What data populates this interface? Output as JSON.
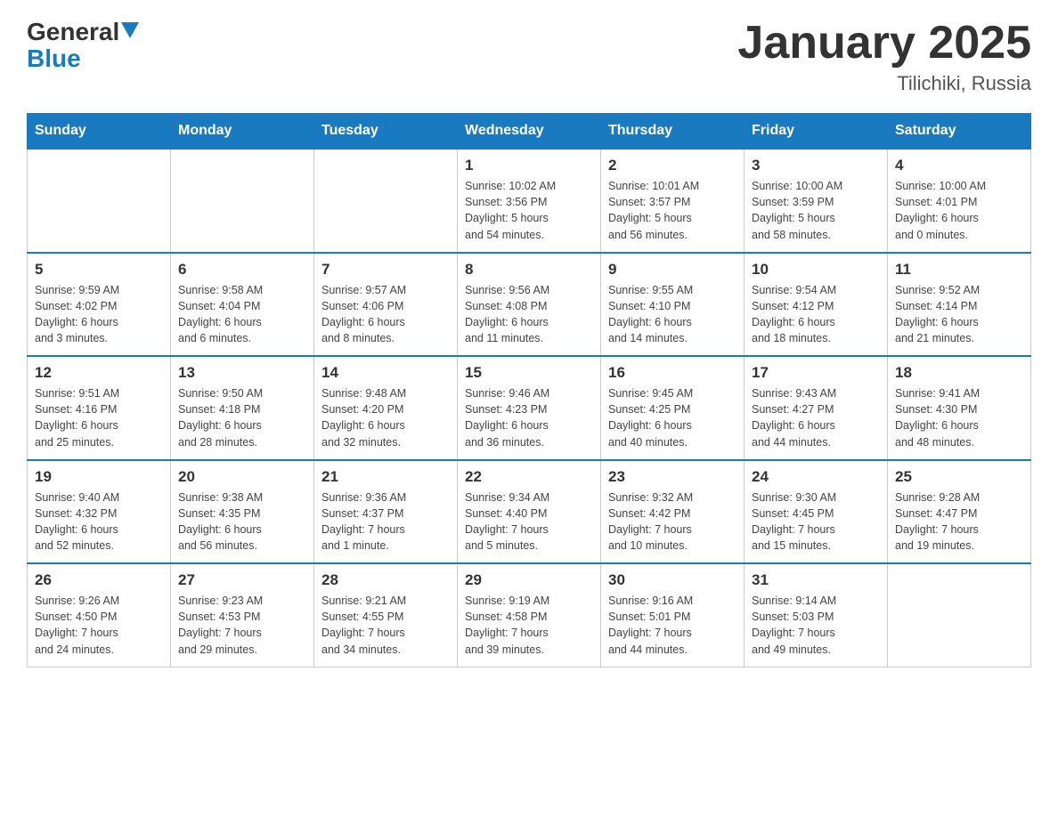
{
  "header": {
    "logo": {
      "general": "General",
      "blue": "Blue"
    },
    "title": "January 2025",
    "subtitle": "Tilichiki, Russia"
  },
  "days_of_week": [
    "Sunday",
    "Monday",
    "Tuesday",
    "Wednesday",
    "Thursday",
    "Friday",
    "Saturday"
  ],
  "weeks": [
    [
      {
        "day": "",
        "info": ""
      },
      {
        "day": "",
        "info": ""
      },
      {
        "day": "",
        "info": ""
      },
      {
        "day": "1",
        "info": "Sunrise: 10:02 AM\nSunset: 3:56 PM\nDaylight: 5 hours\nand 54 minutes."
      },
      {
        "day": "2",
        "info": "Sunrise: 10:01 AM\nSunset: 3:57 PM\nDaylight: 5 hours\nand 56 minutes."
      },
      {
        "day": "3",
        "info": "Sunrise: 10:00 AM\nSunset: 3:59 PM\nDaylight: 5 hours\nand 58 minutes."
      },
      {
        "day": "4",
        "info": "Sunrise: 10:00 AM\nSunset: 4:01 PM\nDaylight: 6 hours\nand 0 minutes."
      }
    ],
    [
      {
        "day": "5",
        "info": "Sunrise: 9:59 AM\nSunset: 4:02 PM\nDaylight: 6 hours\nand 3 minutes."
      },
      {
        "day": "6",
        "info": "Sunrise: 9:58 AM\nSunset: 4:04 PM\nDaylight: 6 hours\nand 6 minutes."
      },
      {
        "day": "7",
        "info": "Sunrise: 9:57 AM\nSunset: 4:06 PM\nDaylight: 6 hours\nand 8 minutes."
      },
      {
        "day": "8",
        "info": "Sunrise: 9:56 AM\nSunset: 4:08 PM\nDaylight: 6 hours\nand 11 minutes."
      },
      {
        "day": "9",
        "info": "Sunrise: 9:55 AM\nSunset: 4:10 PM\nDaylight: 6 hours\nand 14 minutes."
      },
      {
        "day": "10",
        "info": "Sunrise: 9:54 AM\nSunset: 4:12 PM\nDaylight: 6 hours\nand 18 minutes."
      },
      {
        "day": "11",
        "info": "Sunrise: 9:52 AM\nSunset: 4:14 PM\nDaylight: 6 hours\nand 21 minutes."
      }
    ],
    [
      {
        "day": "12",
        "info": "Sunrise: 9:51 AM\nSunset: 4:16 PM\nDaylight: 6 hours\nand 25 minutes."
      },
      {
        "day": "13",
        "info": "Sunrise: 9:50 AM\nSunset: 4:18 PM\nDaylight: 6 hours\nand 28 minutes."
      },
      {
        "day": "14",
        "info": "Sunrise: 9:48 AM\nSunset: 4:20 PM\nDaylight: 6 hours\nand 32 minutes."
      },
      {
        "day": "15",
        "info": "Sunrise: 9:46 AM\nSunset: 4:23 PM\nDaylight: 6 hours\nand 36 minutes."
      },
      {
        "day": "16",
        "info": "Sunrise: 9:45 AM\nSunset: 4:25 PM\nDaylight: 6 hours\nand 40 minutes."
      },
      {
        "day": "17",
        "info": "Sunrise: 9:43 AM\nSunset: 4:27 PM\nDaylight: 6 hours\nand 44 minutes."
      },
      {
        "day": "18",
        "info": "Sunrise: 9:41 AM\nSunset: 4:30 PM\nDaylight: 6 hours\nand 48 minutes."
      }
    ],
    [
      {
        "day": "19",
        "info": "Sunrise: 9:40 AM\nSunset: 4:32 PM\nDaylight: 6 hours\nand 52 minutes."
      },
      {
        "day": "20",
        "info": "Sunrise: 9:38 AM\nSunset: 4:35 PM\nDaylight: 6 hours\nand 56 minutes."
      },
      {
        "day": "21",
        "info": "Sunrise: 9:36 AM\nSunset: 4:37 PM\nDaylight: 7 hours\nand 1 minute."
      },
      {
        "day": "22",
        "info": "Sunrise: 9:34 AM\nSunset: 4:40 PM\nDaylight: 7 hours\nand 5 minutes."
      },
      {
        "day": "23",
        "info": "Sunrise: 9:32 AM\nSunset: 4:42 PM\nDaylight: 7 hours\nand 10 minutes."
      },
      {
        "day": "24",
        "info": "Sunrise: 9:30 AM\nSunset: 4:45 PM\nDaylight: 7 hours\nand 15 minutes."
      },
      {
        "day": "25",
        "info": "Sunrise: 9:28 AM\nSunset: 4:47 PM\nDaylight: 7 hours\nand 19 minutes."
      }
    ],
    [
      {
        "day": "26",
        "info": "Sunrise: 9:26 AM\nSunset: 4:50 PM\nDaylight: 7 hours\nand 24 minutes."
      },
      {
        "day": "27",
        "info": "Sunrise: 9:23 AM\nSunset: 4:53 PM\nDaylight: 7 hours\nand 29 minutes."
      },
      {
        "day": "28",
        "info": "Sunrise: 9:21 AM\nSunset: 4:55 PM\nDaylight: 7 hours\nand 34 minutes."
      },
      {
        "day": "29",
        "info": "Sunrise: 9:19 AM\nSunset: 4:58 PM\nDaylight: 7 hours\nand 39 minutes."
      },
      {
        "day": "30",
        "info": "Sunrise: 9:16 AM\nSunset: 5:01 PM\nDaylight: 7 hours\nand 44 minutes."
      },
      {
        "day": "31",
        "info": "Sunrise: 9:14 AM\nSunset: 5:03 PM\nDaylight: 7 hours\nand 49 minutes."
      },
      {
        "day": "",
        "info": ""
      }
    ]
  ]
}
